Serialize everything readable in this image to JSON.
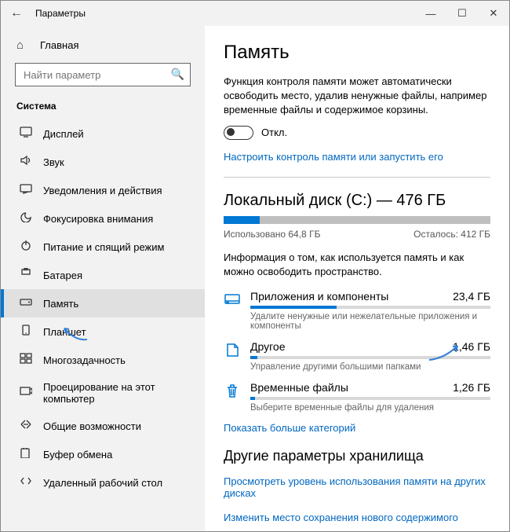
{
  "titlebar": {
    "back": "←",
    "title": "Параметры"
  },
  "sidebar": {
    "home": "Главная",
    "search_placeholder": "Найти параметр",
    "section": "Система",
    "items": [
      {
        "label": "Дисплей"
      },
      {
        "label": "Звук"
      },
      {
        "label": "Уведомления и действия"
      },
      {
        "label": "Фокусировка внимания"
      },
      {
        "label": "Питание и спящий режим"
      },
      {
        "label": "Батарея"
      },
      {
        "label": "Память",
        "active": true
      },
      {
        "label": "Планшет"
      },
      {
        "label": "Многозадачность"
      },
      {
        "label": "Проецирование на этот компьютер"
      },
      {
        "label": "Общие возможности"
      },
      {
        "label": "Буфер обмена"
      },
      {
        "label": "Удаленный рабочий стол"
      }
    ]
  },
  "main": {
    "title": "Память",
    "sense_desc": "Функция контроля памяти может автоматически освободить место, удалив ненужные файлы, например временные файлы и содержимое корзины.",
    "toggle_label": "Откл.",
    "configure_link": "Настроить контроль памяти или запустить его",
    "disk_title": "Локальный диск (C:) — 476 ГБ",
    "used_label": "Использовано 64,8 ГБ",
    "free_label": "Осталось: 412 ГБ",
    "used_pct": 13.6,
    "info": "Информация о том, как используется память и как можно освободить пространство.",
    "categories": [
      {
        "name": "Приложения и компоненты",
        "size": "23,4 ГБ",
        "pct": 36,
        "hint": "Удалите ненужные или нежелательные приложения и компоненты"
      },
      {
        "name": "Другое",
        "size": "1,46 ГБ",
        "pct": 3,
        "hint": "Управление другими большими папками"
      },
      {
        "name": "Временные файлы",
        "size": "1,26 ГБ",
        "pct": 2,
        "hint": "Выберите временные файлы для удаления"
      }
    ],
    "more_link": "Показать больше категорий",
    "other_section": "Другие параметры хранилища",
    "links": [
      "Просмотреть уровень использования памяти на других дисках",
      "Изменить место сохранения нового содержимого"
    ]
  }
}
